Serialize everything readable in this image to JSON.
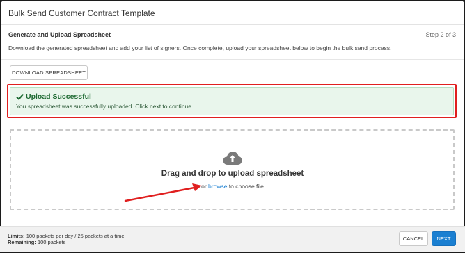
{
  "modal": {
    "title": "Bulk Send Customer Contract Template"
  },
  "step": {
    "heading": "Generate and Upload Spreadsheet",
    "indicator": "Step 2 of 3",
    "description": "Download the generated spreadsheet and add your list of signers. Once complete, upload your spreadsheet below to begin the bulk send process."
  },
  "download_button": "DOWNLOAD SPREADSHEET",
  "success": {
    "icon": "check-icon",
    "title": "Upload Successful",
    "message": "You spreadsheet was successfully uploaded. Click next to continue."
  },
  "dropzone": {
    "icon": "cloud-upload-icon",
    "title": "Drag and drop to upload spreadsheet",
    "sub_prefix": "or",
    "sub_link": "browse",
    "sub_suffix": "to choose file"
  },
  "footer": {
    "limits_label": "Limits:",
    "limits_value": "100 packets per day / 25 packets at a time",
    "remaining_label": "Remaining:",
    "remaining_value": "100 packets",
    "cancel_label": "CANCEL",
    "next_label": "NEXT"
  },
  "colors": {
    "accent": "#1a7fd1",
    "success_bg": "#e9f6ec",
    "success_text": "#1f6b33",
    "annotation_red": "#e01f1f"
  }
}
